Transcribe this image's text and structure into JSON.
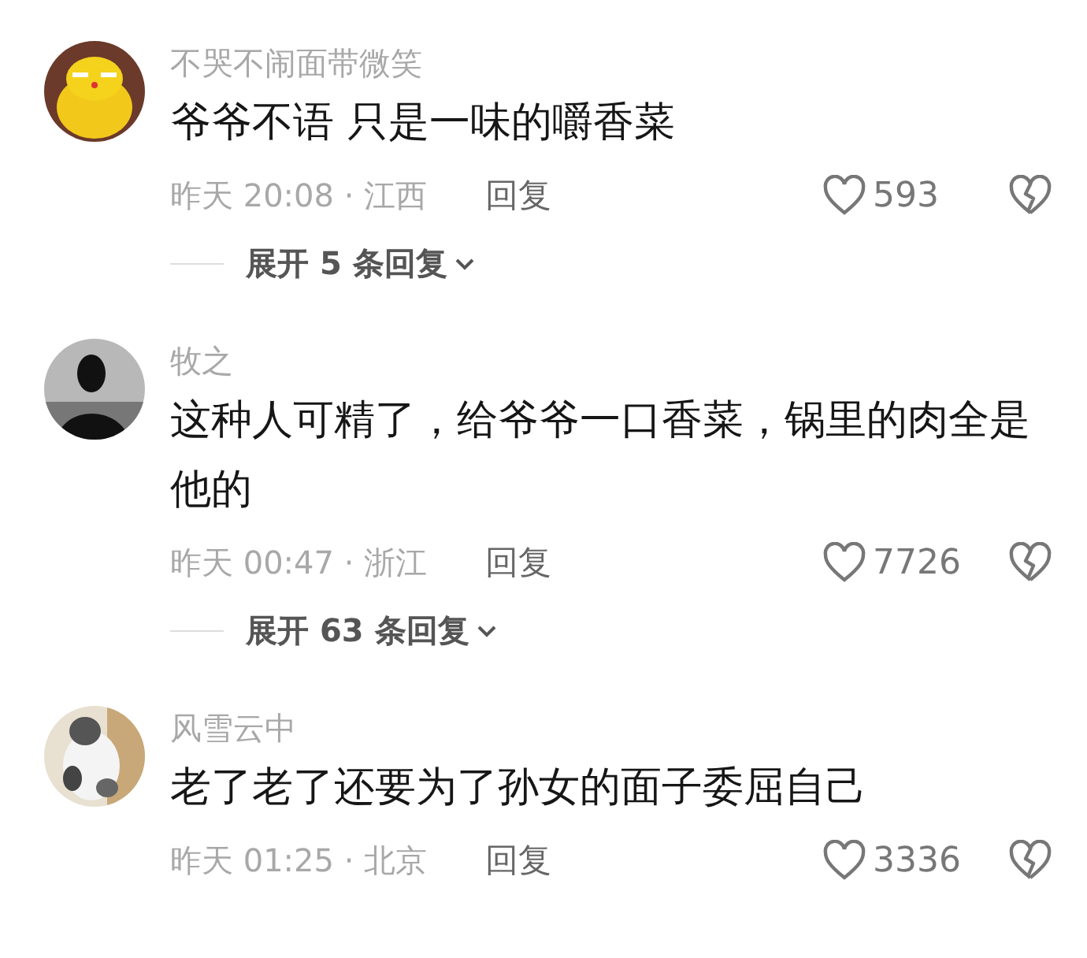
{
  "comments": [
    {
      "username": "不哭不闹面带微笑",
      "text": "爷爷不语 只是一味的嚼香菜",
      "meta": "昨天 20:08 · 江西",
      "reply": "回复",
      "likes": "593",
      "expand": "展开 5 条回复"
    },
    {
      "username": "牧之",
      "text": "这种人可精了，给爷爷一口香菜，锅里的肉全是他的",
      "meta": "昨天 00:47 · 浙江",
      "reply": "回复",
      "likes": "7726",
      "expand": "展开 63 条回复"
    },
    {
      "username": "风雪云中",
      "text": "老了老了还要为了孙女的面子委屈自己",
      "meta": "昨天 01:25 · 北京",
      "reply": "回复",
      "likes": "3336"
    }
  ]
}
